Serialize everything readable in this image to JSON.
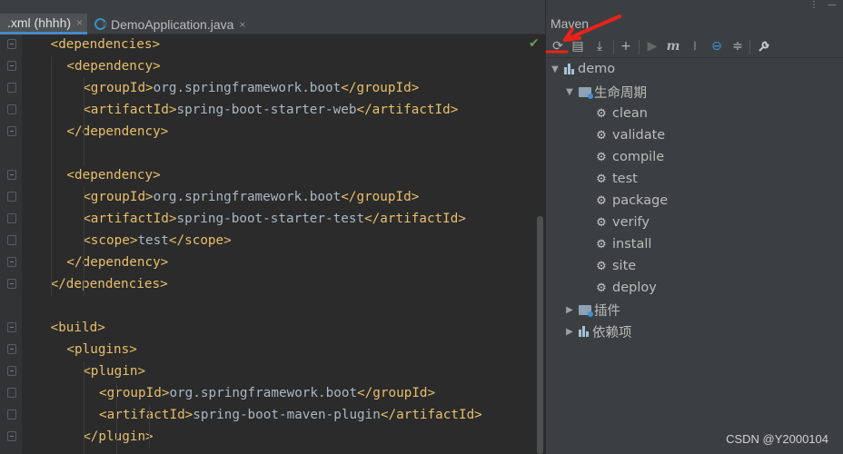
{
  "editor": {
    "tabs": [
      {
        "label": ".xml (hhhh)",
        "close": "×"
      },
      {
        "label": "DemoApplication.java",
        "close": "×"
      }
    ],
    "lines": [
      [
        {
          "c": "tag",
          "t": "<dependencies>"
        }
      ],
      [
        {
          "c": "tag",
          "t": "<dependency>"
        }
      ],
      [
        {
          "c": "tag",
          "t": "<groupId>"
        },
        {
          "c": "txt",
          "t": "org.springframework.boot"
        },
        {
          "c": "tag",
          "t": "</groupId>"
        }
      ],
      [
        {
          "c": "tag",
          "t": "<artifactId>"
        },
        {
          "c": "txt",
          "t": "spring-boot-starter-web"
        },
        {
          "c": "tag",
          "t": "</artifactId>"
        }
      ],
      [
        {
          "c": "tag",
          "t": "</dependency>"
        }
      ],
      [],
      [
        {
          "c": "tag",
          "t": "<dependency>"
        }
      ],
      [
        {
          "c": "tag",
          "t": "<groupId>"
        },
        {
          "c": "txt",
          "t": "org.springframework.boot"
        },
        {
          "c": "tag",
          "t": "</groupId>"
        }
      ],
      [
        {
          "c": "tag",
          "t": "<artifactId>"
        },
        {
          "c": "txt",
          "t": "spring-boot-starter-test"
        },
        {
          "c": "tag",
          "t": "</artifactId>"
        }
      ],
      [
        {
          "c": "tag",
          "t": "<scope>"
        },
        {
          "c": "txt",
          "t": "test"
        },
        {
          "c": "tag",
          "t": "</scope>"
        }
      ],
      [
        {
          "c": "tag",
          "t": "</dependency>"
        }
      ],
      [
        {
          "c": "tag",
          "t": "</dependencies>"
        }
      ],
      [],
      [
        {
          "c": "tag",
          "t": "<build>"
        }
      ],
      [
        {
          "c": "tag",
          "t": "<plugins>"
        }
      ],
      [
        {
          "c": "tag",
          "t": "<plugin>"
        }
      ],
      [
        {
          "c": "tag",
          "t": "<groupId>"
        },
        {
          "c": "txt",
          "t": "org.springframework.boot"
        },
        {
          "c": "tag",
          "t": "</groupId>"
        }
      ],
      [
        {
          "c": "tag",
          "t": "<artifactId>"
        },
        {
          "c": "txt",
          "t": "spring-boot-maven-plugin"
        },
        {
          "c": "tag",
          "t": "</artifactId>"
        }
      ],
      [
        {
          "c": "tag",
          "t": "</plugin>"
        }
      ]
    ],
    "inspection_mark": "✔"
  },
  "maven": {
    "title": "Maven",
    "window_controls": [
      "⋮",
      "—"
    ],
    "toolbar_icons": [
      "reload-icon",
      "add-maven-project-icon",
      "download-icon",
      "plus-icon",
      "run-icon",
      "execute-goal-icon",
      "toggle-offline-icon",
      "skip-tests-icon",
      "collapse-all-icon",
      "settings-wrench-icon"
    ],
    "toolbar_glyphs": [
      "⟳",
      "▤",
      "⤓",
      "+",
      "▶",
      "m",
      "⧘",
      "⊖",
      "≑",
      "🔧"
    ],
    "project": "demo",
    "lifecycle": {
      "label": "生命周期",
      "goals": [
        "clean",
        "validate",
        "compile",
        "test",
        "package",
        "verify",
        "install",
        "site",
        "deploy"
      ]
    },
    "plugins_label": "插件",
    "dependencies_label": "依赖项"
  },
  "annotation": {
    "color": "#e8231b"
  },
  "watermark": "CSDN @Y2000104"
}
